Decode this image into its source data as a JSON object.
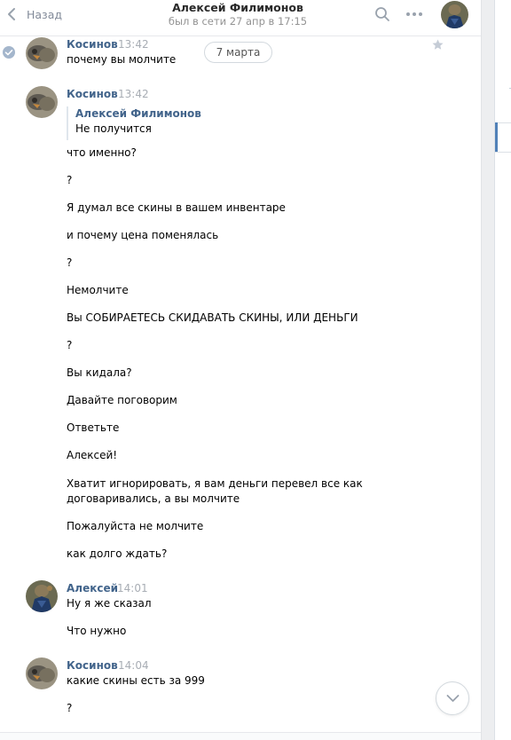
{
  "header": {
    "back_label": "Назад",
    "title": "Алексей Филимонов",
    "subtitle": "был в сети 27 апр в 17:15"
  },
  "date_divider": "7 марта",
  "messages": [
    {
      "author": "Косинов",
      "time": "13:42",
      "lines": [
        "почему вы молчите"
      ]
    },
    {
      "author": "Косинов",
      "time": "13:42",
      "quote": {
        "author": "Алексей Филимонов",
        "text": "Не получится"
      },
      "lines": [
        "что именно?",
        "?",
        "Я думал все скины в вашем инвентаре",
        "и почему цена поменялась",
        "?",
        "Немолчите",
        "Вы СОБИРАЕТЕСЬ СКИДАВАТЬ СКИНЫ, ИЛИ ДЕНЬГИ",
        "?",
        "Вы кидала?",
        "Давайте поговорим",
        "Ответьте",
        "Алексей!",
        "Хватит игнорировать, я вам деньги перевел все как",
        "договаривались, а вы молчите",
        "Пожалуйста не молчите",
        "как долго ждать?"
      ]
    },
    {
      "author": "Алексей",
      "time": "14:01",
      "lines": [
        "Ну я же сказал",
        "Что нужно"
      ]
    },
    {
      "author": "Косинов",
      "time": "14:04",
      "lines": [
        "какие скины есть за 999",
        "?"
      ]
    }
  ],
  "colors": {
    "name_link": "#42648b",
    "time": "#a8adb4",
    "accent": "#5181b8"
  },
  "icons": [
    "back-chevron-icon",
    "search-icon",
    "more-icon",
    "star-icon",
    "check-icon",
    "chevron-down-icon"
  ]
}
